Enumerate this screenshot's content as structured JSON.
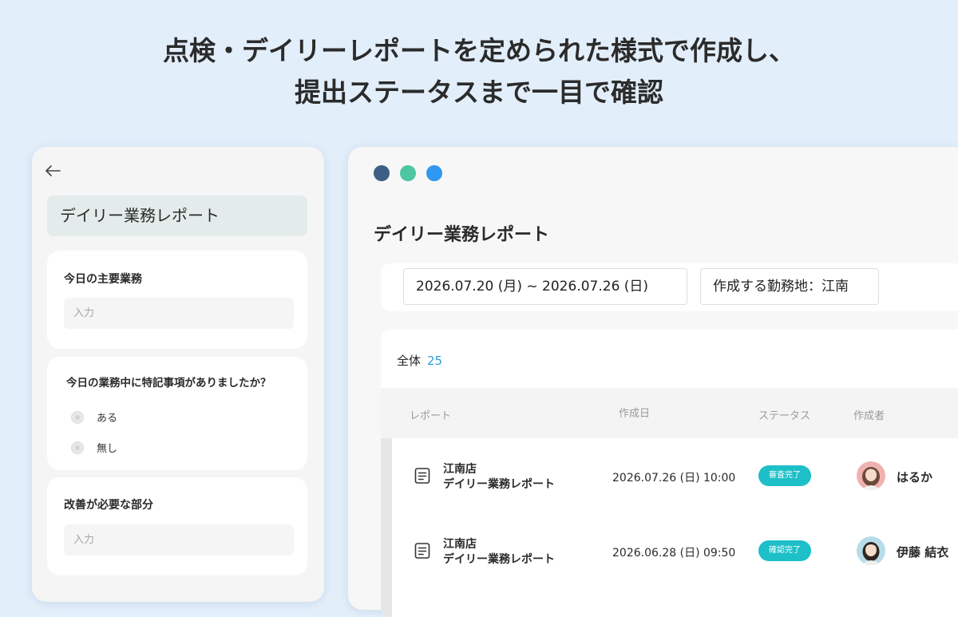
{
  "headline": {
    "line1": "点検・デイリーレポートを定められた様式で作成し、",
    "line2": "提出ステータスまで一目で確認"
  },
  "mobile": {
    "title": "デイリー業務レポート",
    "fields": [
      {
        "label": "今日の主要業務",
        "placeholder": "入力",
        "value": ""
      },
      {
        "label": "今日の業務中に特記事項がありましたか？",
        "options": [
          "ある",
          "無し"
        ]
      },
      {
        "label": "改善が必要な部分",
        "placeholder": "入力",
        "value": ""
      }
    ]
  },
  "window": {
    "dots": [
      "#3d5f86",
      "#4cc7a2",
      "#2f98f0"
    ],
    "title": "デイリー業務レポート",
    "filters": {
      "date_range": "2026.07.20 (月) ~ 2026.07.26 (日)",
      "location": "作成する勤務地：江南"
    },
    "total_label": "全体",
    "total_count": "25",
    "columns": [
      "レポート",
      "作成日",
      "ステータス",
      "作成者"
    ],
    "rows": [
      {
        "store": "江南店",
        "report": "デイリー業務レポート",
        "date": "2026.07.26 (日) 10:00",
        "status": "審査完了",
        "author": "はるか"
      },
      {
        "store": "江南店",
        "report": "デイリー業務レポート",
        "date": "2026.06.28 (日) 09:50",
        "status": "確認完了",
        "author": "伊藤 結衣"
      }
    ],
    "status_color": "#1dbfc8",
    "total_count_color": "#2f9bd8"
  }
}
